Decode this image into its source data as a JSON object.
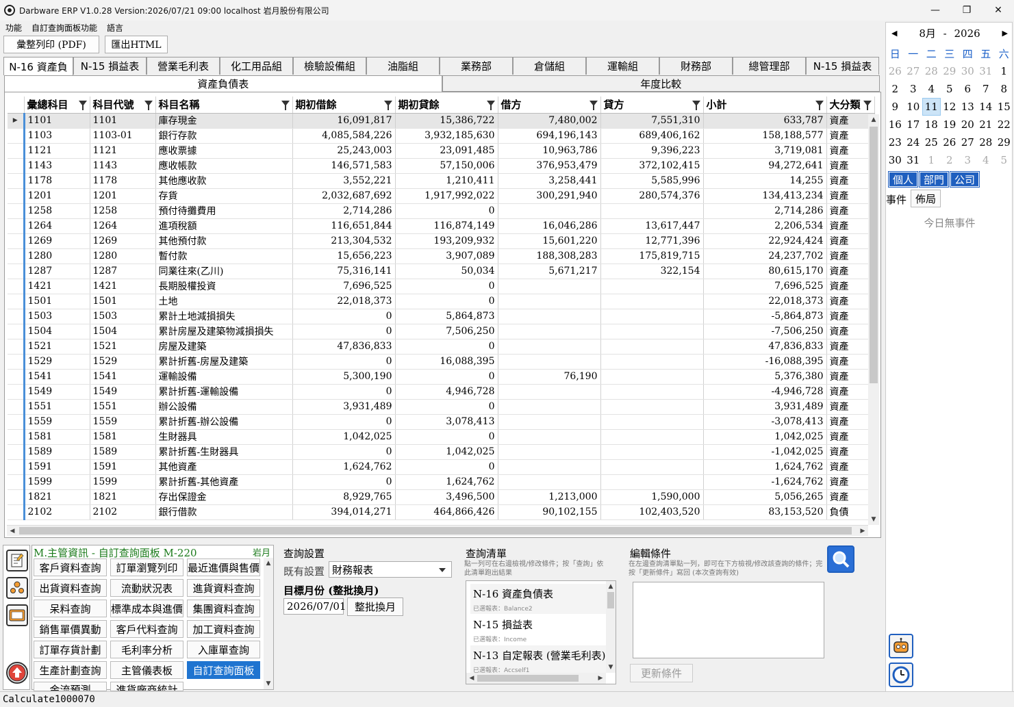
{
  "window": {
    "title": "Darbware ERP V1.0.28 Version:2026/07/21 09:00   localhost 岩月股份有限公司"
  },
  "menu": [
    "功能",
    "自訂查詢面板功能",
    "語言"
  ],
  "toolbar": {
    "print_pdf": "彙整列印 (PDF)",
    "export_html": "匯出HTML"
  },
  "tabs": [
    "N-16 資產負",
    "N-15 損益表",
    "營業毛利表",
    "化工用品組",
    "檢驗設備組",
    "油脂組",
    "業務部",
    "倉儲組",
    "運輸組",
    "財務部",
    "總管理部",
    "N-15 損益表"
  ],
  "subtabs": [
    "資產負債表",
    "年度比較"
  ],
  "grid": {
    "columns": [
      "彙總科目",
      "科目代號",
      "科目名稱",
      "期初借餘",
      "期初貸餘",
      "借方",
      "貸方",
      "小計",
      "大分類"
    ],
    "rows": [
      [
        "1101",
        "1101",
        "庫存現金",
        "16,091,817",
        "15,386,722",
        "7,480,002",
        "7,551,310",
        "633,787",
        "資產"
      ],
      [
        "1103",
        "1103-01",
        "銀行存款",
        "4,085,584,226",
        "3,932,185,630",
        "694,196,143",
        "689,406,162",
        "158,188,577",
        "資產"
      ],
      [
        "1121",
        "1121",
        "應收票據",
        "25,243,003",
        "23,091,485",
        "10,963,786",
        "9,396,223",
        "3,719,081",
        "資產"
      ],
      [
        "1143",
        "1143",
        "應收帳款",
        "146,571,583",
        "57,150,006",
        "376,953,479",
        "372,102,415",
        "94,272,641",
        "資產"
      ],
      [
        "1178",
        "1178",
        "其他應收款",
        "3,552,221",
        "1,210,411",
        "3,258,441",
        "5,585,996",
        "14,255",
        "資產"
      ],
      [
        "1201",
        "1201",
        "存貨",
        "2,032,687,692",
        "1,917,992,022",
        "300,291,940",
        "280,574,376",
        "134,413,234",
        "資產"
      ],
      [
        "1258",
        "1258",
        "預付待攤費用",
        "2,714,286",
        "0",
        "",
        "",
        "2,714,286",
        "資產"
      ],
      [
        "1264",
        "1264",
        "進項稅額",
        "116,651,844",
        "116,874,149",
        "16,046,286",
        "13,617,447",
        "2,206,534",
        "資產"
      ],
      [
        "1269",
        "1269",
        "其他預付款",
        "213,304,532",
        "193,209,932",
        "15,601,220",
        "12,771,396",
        "22,924,424",
        "資產"
      ],
      [
        "1280",
        "1280",
        "暫付款",
        "15,656,223",
        "3,907,089",
        "188,308,283",
        "175,819,715",
        "24,237,702",
        "資產"
      ],
      [
        "1287",
        "1287",
        "同業往來(乙川)",
        "75,316,141",
        "50,034",
        "5,671,217",
        "322,154",
        "80,615,170",
        "資產"
      ],
      [
        "1421",
        "1421",
        "長期股權投資",
        "7,696,525",
        "0",
        "",
        "",
        "7,696,525",
        "資產"
      ],
      [
        "1501",
        "1501",
        "土地",
        "22,018,373",
        "0",
        "",
        "",
        "22,018,373",
        "資產"
      ],
      [
        "1503",
        "1503",
        "累計土地減損損失",
        "0",
        "5,864,873",
        "",
        "",
        "-5,864,873",
        "資產"
      ],
      [
        "1504",
        "1504",
        "累計房屋及建築物減損損失",
        "0",
        "7,506,250",
        "",
        "",
        "-7,506,250",
        "資產"
      ],
      [
        "1521",
        "1521",
        "房屋及建築",
        "47,836,833",
        "0",
        "",
        "",
        "47,836,833",
        "資產"
      ],
      [
        "1529",
        "1529",
        "累計折舊-房屋及建築",
        "0",
        "16,088,395",
        "",
        "",
        "-16,088,395",
        "資產"
      ],
      [
        "1541",
        "1541",
        "運輸設備",
        "5,300,190",
        "0",
        "76,190",
        "",
        "5,376,380",
        "資產"
      ],
      [
        "1549",
        "1549",
        "累計折舊-運輸設備",
        "0",
        "4,946,728",
        "",
        "",
        "-4,946,728",
        "資產"
      ],
      [
        "1551",
        "1551",
        "辦公設備",
        "3,931,489",
        "0",
        "",
        "",
        "3,931,489",
        "資產"
      ],
      [
        "1559",
        "1559",
        "累計折舊-辦公設備",
        "0",
        "3,078,413",
        "",
        "",
        "-3,078,413",
        "資產"
      ],
      [
        "1581",
        "1581",
        "生財器具",
        "1,042,025",
        "0",
        "",
        "",
        "1,042,025",
        "資產"
      ],
      [
        "1589",
        "1589",
        "累計折舊-生財器具",
        "0",
        "1,042,025",
        "",
        "",
        "-1,042,025",
        "資產"
      ],
      [
        "1591",
        "1591",
        "其他資產",
        "1,624,762",
        "0",
        "",
        "",
        "1,624,762",
        "資產"
      ],
      [
        "1599",
        "1599",
        "累計折舊-其他資產",
        "0",
        "1,624,762",
        "",
        "",
        "-1,624,762",
        "資產"
      ],
      [
        "1821",
        "1821",
        "存出保證金",
        "8,929,765",
        "3,496,500",
        "1,213,000",
        "1,590,000",
        "5,056,265",
        "資產"
      ],
      [
        "2102",
        "2102",
        "銀行借款",
        "394,014,271",
        "464,866,426",
        "90,102,155",
        "102,403,520",
        "83,153,520",
        "負債"
      ]
    ]
  },
  "calendar": {
    "month_label": "8月",
    "sep": "-",
    "year_label": "2026",
    "dow": [
      "日",
      "一",
      "二",
      "三",
      "四",
      "五",
      "六"
    ],
    "weeks": [
      [
        "26",
        "27",
        "28",
        "29",
        "30",
        "31",
        "1"
      ],
      [
        "2",
        "3",
        "4",
        "5",
        "6",
        "7",
        "8"
      ],
      [
        "9",
        "10",
        "11",
        "12",
        "13",
        "14",
        "15"
      ],
      [
        "16",
        "17",
        "18",
        "19",
        "20",
        "21",
        "22"
      ],
      [
        "23",
        "24",
        "25",
        "26",
        "27",
        "28",
        "29"
      ],
      [
        "30",
        "31",
        "1",
        "2",
        "3",
        "4",
        "5"
      ]
    ],
    "today": "11",
    "scope_buttons": [
      "個人",
      "部門",
      "公司"
    ],
    "event_label": "事件",
    "layout_button": "佈局",
    "no_events": "今日無事件"
  },
  "panel": {
    "title": "M.主管資訊 - 自訂查詢面板  M-220",
    "corner": "岩月",
    "buttons": [
      "客戶資料查詢",
      "訂單瀏覽列印",
      "最近進價與售價",
      "出貨資料查詢",
      "流動狀況表",
      "進貨資料查詢",
      "呆料查詢",
      "標準成本與進價",
      "集團資料查詢",
      "銷售單價異動",
      "客戶代料查詢",
      "加工資料查詢",
      "訂單存貨計劃",
      "毛利率分析",
      "入庫單查詢",
      "生產計劃查詢",
      "主管儀表板",
      "自訂查詢面板",
      "金流預測",
      "進貨廠商統計"
    ]
  },
  "query_settings": {
    "title": "查詢設置",
    "existing_label": "既有設置",
    "existing_value": "財務報表",
    "target_month_label": "目標月份 (整批換月)",
    "target_month_value": "2026/07/01",
    "batch_button": "整批換月"
  },
  "query_list": {
    "title": "查詢清單",
    "hint": "點一列可在右邊檢視/修改條件；按「查詢」依此清單跑出結果",
    "items": [
      {
        "title": "N-16 資產負債表",
        "sub": "已選報表：Balance2"
      },
      {
        "title": "N-15 損益表",
        "sub": "已選報表：Income"
      },
      {
        "title": "N-13 自定報表 (營業毛利表)",
        "sub": "已選報表：Accself1"
      }
    ]
  },
  "edit_conditions": {
    "title": "編輯條件",
    "hint": "在左邊查詢清單點一列，即可在下方檢視/修改該查詢的條件；完按「更新條件」寫回 (本次查詢有效)",
    "update_button": "更新條件"
  },
  "status": {
    "text": "Calculate1000070"
  }
}
